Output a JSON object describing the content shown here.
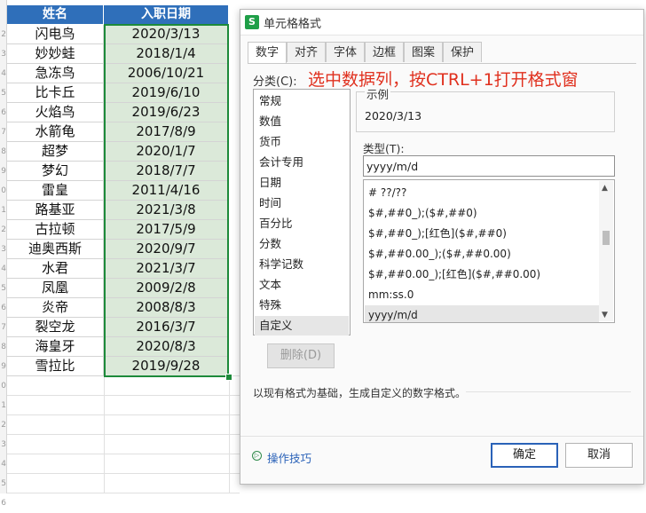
{
  "sheet": {
    "headers": {
      "name": "姓名",
      "date": "入职日期"
    },
    "rows": [
      {
        "name": "闪电鸟",
        "date": "2020/3/13"
      },
      {
        "name": "妙妙蛙",
        "date": "2018/1/4"
      },
      {
        "name": "急冻鸟",
        "date": "2006/10/21"
      },
      {
        "name": "比卡丘",
        "date": "2019/6/10"
      },
      {
        "name": "火焰鸟",
        "date": "2019/6/23"
      },
      {
        "name": "水箭龟",
        "date": "2017/8/9"
      },
      {
        "name": "超梦",
        "date": "2020/1/7"
      },
      {
        "name": "梦幻",
        "date": "2018/7/7"
      },
      {
        "name": "雷皇",
        "date": "2011/4/16"
      },
      {
        "name": "路基亚",
        "date": "2021/3/8"
      },
      {
        "name": "古拉顿",
        "date": "2017/5/9"
      },
      {
        "name": "迪奥西斯",
        "date": "2020/9/7"
      },
      {
        "name": "水君",
        "date": "2021/3/7"
      },
      {
        "name": "凤凰",
        "date": "2009/2/8"
      },
      {
        "name": "炎帝",
        "date": "2008/8/3"
      },
      {
        "name": "裂空龙",
        "date": "2016/3/7"
      },
      {
        "name": "海皇牙",
        "date": "2020/8/3"
      },
      {
        "name": "雪拉比",
        "date": "2019/9/28"
      }
    ],
    "row_numbers": [
      "2",
      "3",
      "4",
      "5",
      "6",
      "7",
      "8",
      "9",
      "0",
      "1",
      "2",
      "3",
      "4",
      "5",
      "6",
      "7",
      "8",
      "9",
      "0",
      "1",
      "2",
      "3",
      "4",
      "5",
      "6"
    ],
    "colors": {
      "header_bg": "#2f6fba",
      "selection_fill": "#dbe9d9",
      "selection_border": "#1d8a3a"
    }
  },
  "dialog": {
    "title": "单元格格式",
    "app_icon": "S",
    "tabs": [
      "数字",
      "对齐",
      "字体",
      "边框",
      "图案",
      "保护"
    ],
    "active_tab": "数字",
    "category_label": "分类(C):",
    "categories": [
      "常规",
      "数值",
      "货币",
      "会计专用",
      "日期",
      "时间",
      "百分比",
      "分数",
      "科学记数",
      "文本",
      "特殊",
      "自定义"
    ],
    "selected_category": "自定义",
    "delete_label": "删除(D)",
    "annotation": "选中数据列，按CTRL+1打开格式窗",
    "sample_label": "示例",
    "sample_value": "2020/3/13",
    "type_label": "类型(T):",
    "type_value": "yyyy/m/d",
    "formats": [
      "# ??/??",
      "$#,##0_);($#,##0)",
      "$#,##0_);[红色]($#,##0)",
      "$#,##0.00_);($#,##0.00)",
      "$#,##0.00_);[红色]($#,##0.00)",
      "mm:ss.0",
      "yyyy/m/d"
    ],
    "selected_format": "yyyy/m/d",
    "description": "以现有格式为基础，生成自定义的数字格式。",
    "tips_label": "操作技巧",
    "ok_label": "确定",
    "cancel_label": "取消",
    "scroll_up": "▲",
    "scroll_down": "▼",
    "tips_glyph": "▷"
  }
}
